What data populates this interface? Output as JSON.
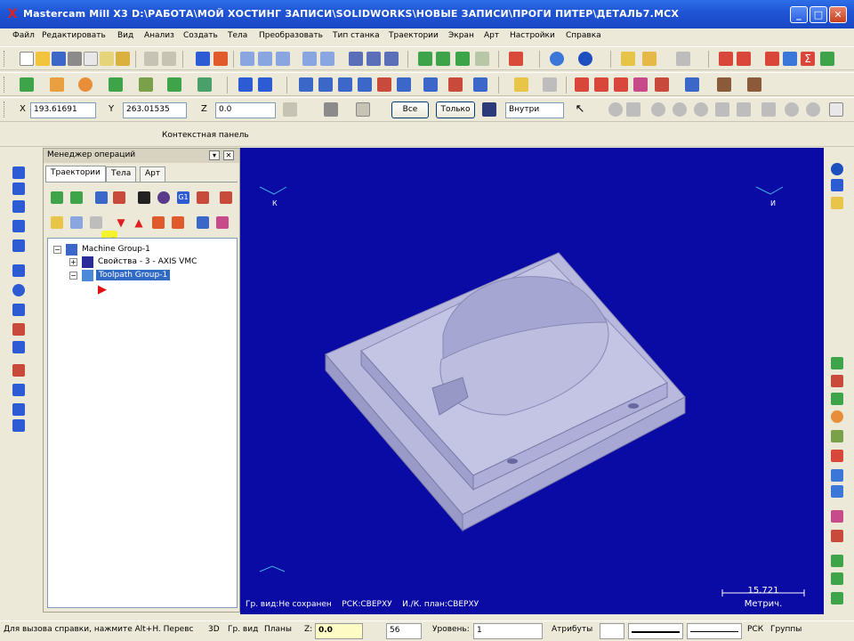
{
  "window": {
    "app_icon": "mastercam-x-icon",
    "title": "Mastercam Mill X3  D:\\РАБОТА\\МОЙ ХОСТИНГ ЗАПИСИ\\SOLIDWORKS\\НОВЫЕ ЗАПИСИ\\ПРОГИ ПИТЕР\\ДЕТАЛЬ7.MCX",
    "min_label": "_",
    "max_label": "□",
    "close_label": "✕"
  },
  "menu": [
    "Файл",
    "Редактировать",
    "Вид",
    "Анализ",
    "Создать",
    "Тела",
    "Преобразовать",
    "Тип станка",
    "Траектории",
    "Экран",
    "Арт",
    "Настройки",
    "Справка"
  ],
  "autocursor": {
    "x_label": "X",
    "x_value": "193.61691",
    "y_label": "Y",
    "y_value": "263.01535",
    "z_label": "Z",
    "z_value": "0.0",
    "all_button": "Все",
    "only_button": "Только",
    "mode_value": "Внутри"
  },
  "context_panel_label": "Контекстная панель",
  "op_manager": {
    "title": "Менеджер операций",
    "pin_label": "▾",
    "close_label": "✕",
    "tabs": [
      "Траектории",
      "Тела",
      "Арт"
    ],
    "tree": {
      "machine_group": "Machine Group-1",
      "properties": "Свойства - 3 - AXIS VMC",
      "toolpath_group": "Toolpath Group-1"
    }
  },
  "viewport": {
    "top_left_axis": "К",
    "top_right_axis": "И",
    "status_view": "Гр. вид:Не сохранен",
    "status_cs": "РСК:СВЕРХУ",
    "status_plane": "И./К. план:СВЕРХУ",
    "scale_value": "15.721",
    "scale_unit": "Метрич.",
    "background_color": "#0a0aa4",
    "part_color": "#b9b9dd"
  },
  "statusbar": {
    "help_text": "Для вызова справки, нажмите Alt+H. Перевс",
    "mode_3d": "3D",
    "view_label": "Гр. вид",
    "planes_label": "Планы",
    "z_label": "Z:",
    "z_value": "0.0",
    "color_value": "56",
    "level_label": "Уровень:",
    "level_value": "1",
    "attributes_label": "Атрибуты",
    "rsk_label": "РСК",
    "groups_label": "Группы"
  }
}
